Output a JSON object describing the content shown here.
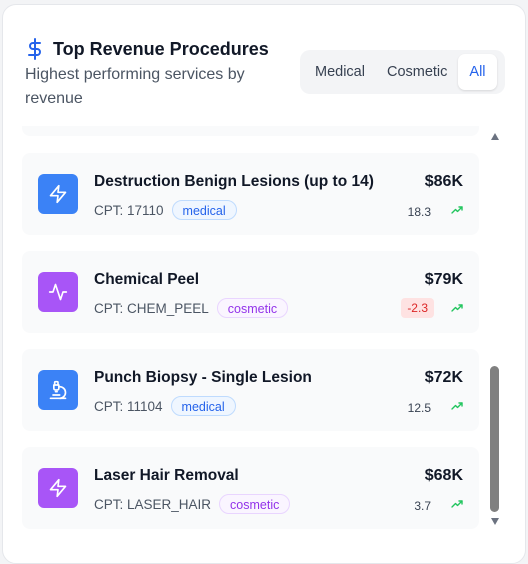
{
  "header": {
    "title": "Top Revenue Procedures",
    "subtitle": "Highest performing services by revenue"
  },
  "filters": {
    "options": [
      "Medical",
      "Cosmetic",
      "All"
    ],
    "selected": "All"
  },
  "colors": {
    "medical": "#3b82f6",
    "cosmetic": "#a855f7",
    "positive": "#22c55e",
    "negative": "#dc2626",
    "accent": "#2563eb"
  },
  "procedures": [
    {
      "name": "Destruction Benign Lesions (up to 14)",
      "cpt": "CPT: 17110",
      "category": "medical",
      "revenue": "$86K",
      "growth": "18.3",
      "icon": "zap-icon"
    },
    {
      "name": "Chemical Peel",
      "cpt": "CPT: CHEM_PEEL",
      "category": "cosmetic",
      "revenue": "$79K",
      "growth": "-2.3",
      "icon": "activity-icon"
    },
    {
      "name": "Punch Biopsy - Single Lesion",
      "cpt": "CPT: 11104",
      "category": "medical",
      "revenue": "$72K",
      "growth": "12.5",
      "icon": "microscope-icon"
    },
    {
      "name": "Laser Hair Removal",
      "cpt": "CPT: LASER_HAIR",
      "category": "cosmetic",
      "revenue": "$68K",
      "growth": "3.7",
      "icon": "zap-icon"
    }
  ]
}
